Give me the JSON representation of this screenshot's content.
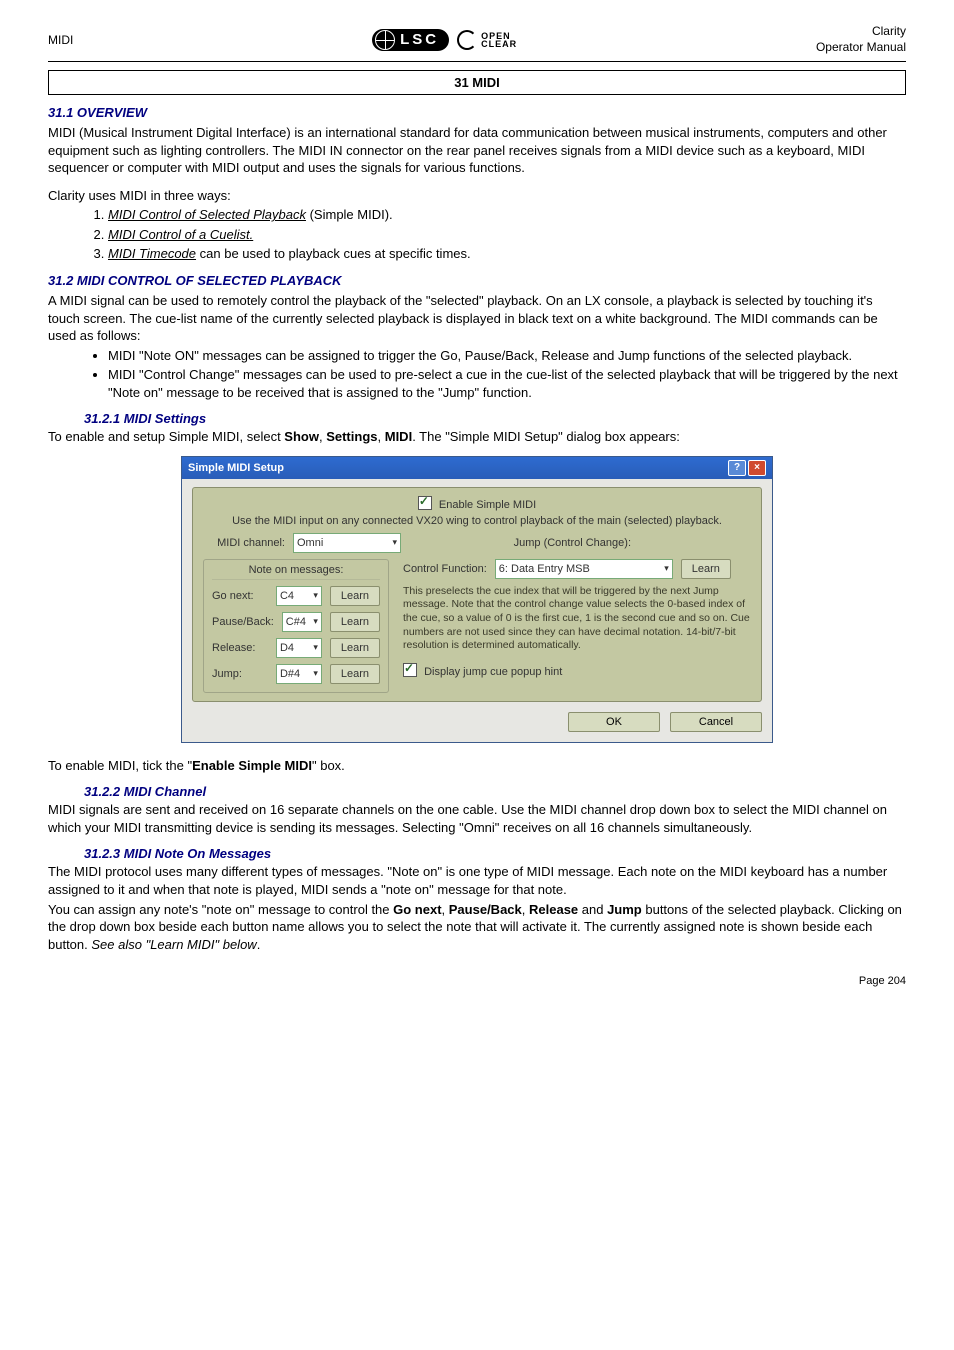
{
  "header": {
    "left": "MIDI",
    "right1": "Clarity",
    "right2": "Operator Manual",
    "lsc": "LSC",
    "oc1": "OPEN",
    "oc2": "CLEAR"
  },
  "section_title": "31 MIDI",
  "s311": {
    "heading": "31.1 OVERVIEW",
    "para1": "MIDI (Musical Instrument Digital Interface) is an international standard for data communication between musical instruments, computers and other equipment such as lighting controllers. The MIDI IN connector on the rear panel receives signals from a MIDI device such as a keyboard, MIDI sequencer or computer with MIDI output and uses the signals for various functions.",
    "para2": "Clarity uses MIDI in three ways:",
    "li1a": "MIDI Control of Selected Playback",
    "li1b": " (Simple MIDI).",
    "li2": "MIDI Control of a Cuelist.",
    "li3a": "MIDI Timecode",
    "li3b": " can be used to playback cues at specific times."
  },
  "s312": {
    "heading": "31.2 MIDI CONTROL OF SELECTED PLAYBACK",
    "para1": "A MIDI signal can be used to remotely control the playback of the \"selected\" playback. On an LX console, a playback is selected by touching it's touch screen. The cue-list name of the currently selected playback is displayed in black text on a white background. The MIDI commands can be used as follows:",
    "b1": "MIDI \"Note ON\" messages can be assigned to trigger the Go, Pause/Back, Release and Jump functions of the selected playback.",
    "b2": "MIDI \"Control Change\" messages can be used to pre-select a cue in the cue-list of the selected playback that will be triggered by the next \"Note on\" message to be received that is assigned to the \"Jump\" function."
  },
  "s3121": {
    "heading": "31.2.1   MIDI Settings",
    "para_pre": "To enable and setup Simple MIDI, select ",
    "show": "Show",
    "comma1": ", ",
    "settings": "Settings",
    "comma2": ", ",
    "midi": "MIDI",
    "para_post": ". The \"Simple MIDI Setup\" dialog box appears:"
  },
  "dialog": {
    "title": "Simple MIDI Setup",
    "help": "?",
    "close": "×",
    "enable": "Enable Simple MIDI",
    "hint": "Use the MIDI input on any connected VX20 wing to control playback of the main (selected) playback.",
    "midi_channel_lbl": "MIDI channel:",
    "midi_channel_val": "Omni",
    "notes_head": "Note on messages:",
    "go_next": "Go next:",
    "pause_back": "Pause/Back:",
    "release": "Release:",
    "jump": "Jump:",
    "c4": "C4",
    "cs4": "C#4",
    "d4": "D4",
    "ds4": "D#4",
    "learn": "Learn",
    "jump_head": "Jump (Control Change):",
    "ctrl_func_lbl": "Control Function:",
    "ctrl_func_val": "6: Data Entry MSB",
    "jump_desc": "This preselects the cue index that will be triggered by the next Jump message. Note that the control change value selects the 0-based index of the cue, so a value of 0 is the first cue, 1 is the second cue and so on. Cue numbers are not used since they can have decimal notation. 14-bit/7-bit resolution is determined automatically.",
    "display_hint": "Display jump cue popup hint",
    "ok": "OK",
    "cancel": "Cancel"
  },
  "after_dialog": {
    "pre": "To enable MIDI, tick the \"",
    "bold": "Enable Simple MIDI",
    "post": "\" box."
  },
  "s3122": {
    "heading": "31.2.2   MIDI Channel",
    "para": "MIDI signals are sent and received on 16 separate channels on the one cable. Use the MIDI channel drop down box to select the MIDI channel on which your MIDI transmitting device is sending its messages. Selecting \"Omni\" receives on all 16 channels simultaneously."
  },
  "s3123": {
    "heading": "31.2.3   MIDI Note On Messages",
    "para1": "The MIDI protocol uses many different types of messages. \"Note on\" is one type of MIDI message. Each note on the MIDI keyboard has a number assigned to it and when that note is played, MIDI sends a \"note on\" message for that note.",
    "p2_a": "You can assign any note's \"note on\" message to control the ",
    "go_next": "Go next",
    "c1": ", ",
    "pause_back": "Pause/Back",
    "c2": ", ",
    "release": "Release",
    "and": " and ",
    "jump": "Jump",
    "p2_b": " buttons of the selected playback. Clicking on the drop down box beside each button name allows you to select the note that will activate it. The currently assigned note is shown beside each button. ",
    "ital": "See also \"Learn MIDI\" below",
    "dot": "."
  },
  "page_num": "Page 204"
}
